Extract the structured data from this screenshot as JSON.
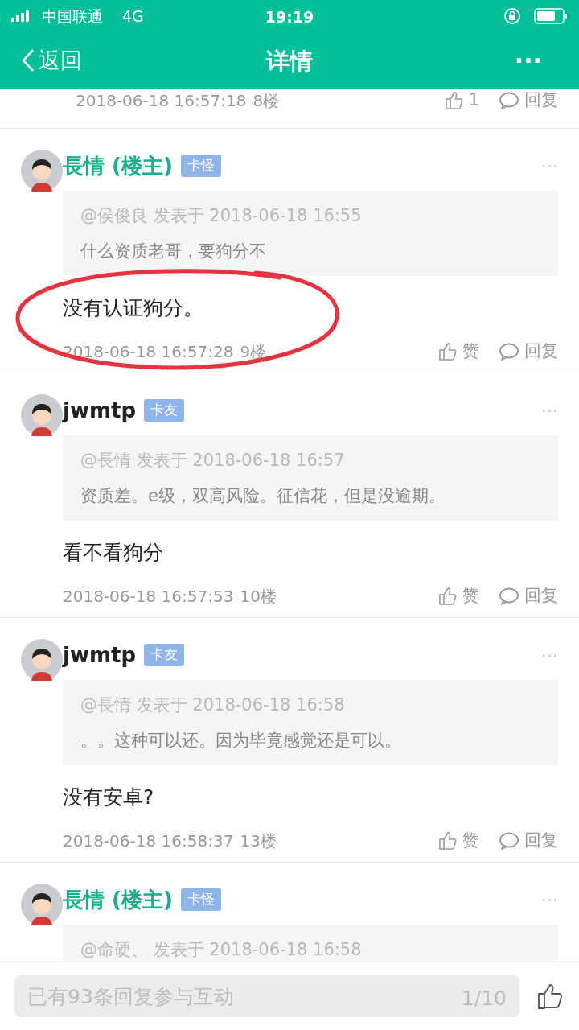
{
  "status_bar": {
    "carrier": "中国联通",
    "network": "4G",
    "time": "19:19"
  },
  "header": {
    "back": "返回",
    "title": "详情",
    "more": "···"
  },
  "posts": [
    {
      "kind": "partial",
      "time": "2018-06-18 16:57:18",
      "floor": "8楼",
      "like": "1",
      "reply": "回复"
    },
    {
      "kind": "full",
      "author": "長情 (楼主)",
      "is_owner": true,
      "badge": "卡怪",
      "more": "···",
      "quote_head": "@侯俊良 发表于 2018-06-18 16:55",
      "quote_text": "什么资质老哥，要狗分不",
      "body": "没有认证狗分。",
      "time": "2018-06-18 16:57:28",
      "floor": "9楼",
      "like": "赞",
      "reply": "回复",
      "circled": true
    },
    {
      "kind": "full",
      "author": "jwmtp",
      "is_owner": false,
      "badge": "卡友",
      "more": "···",
      "quote_head": "@長情 发表于 2018-06-18 16:57",
      "quote_text": "资质差。e级，双高风险。征信花，但是没逾期。",
      "body": "看不看狗分",
      "time": "2018-06-18 16:57:53",
      "floor": "10楼",
      "like": "赞",
      "reply": "回复",
      "circled": false
    },
    {
      "kind": "full",
      "author": "jwmtp",
      "is_owner": false,
      "badge": "卡友",
      "more": "···",
      "quote_head": "@長情 发表于 2018-06-18 16:58",
      "quote_text": "。。这种可以还。因为毕竟感觉还是可以。",
      "body": "没有安卓?",
      "time": "2018-06-18 16:58:37",
      "floor": "13楼",
      "like": "赞",
      "reply": "回复",
      "circled": false
    },
    {
      "kind": "full",
      "author": "長情 (楼主)",
      "is_owner": true,
      "badge": "卡怪",
      "more": "···",
      "quote_head": "@命硬、 发表于 2018-06-18 16:58",
      "circled": false
    }
  ],
  "reply_bar": {
    "placeholder": "已有93条回复参与互动",
    "counter": "1/10"
  }
}
